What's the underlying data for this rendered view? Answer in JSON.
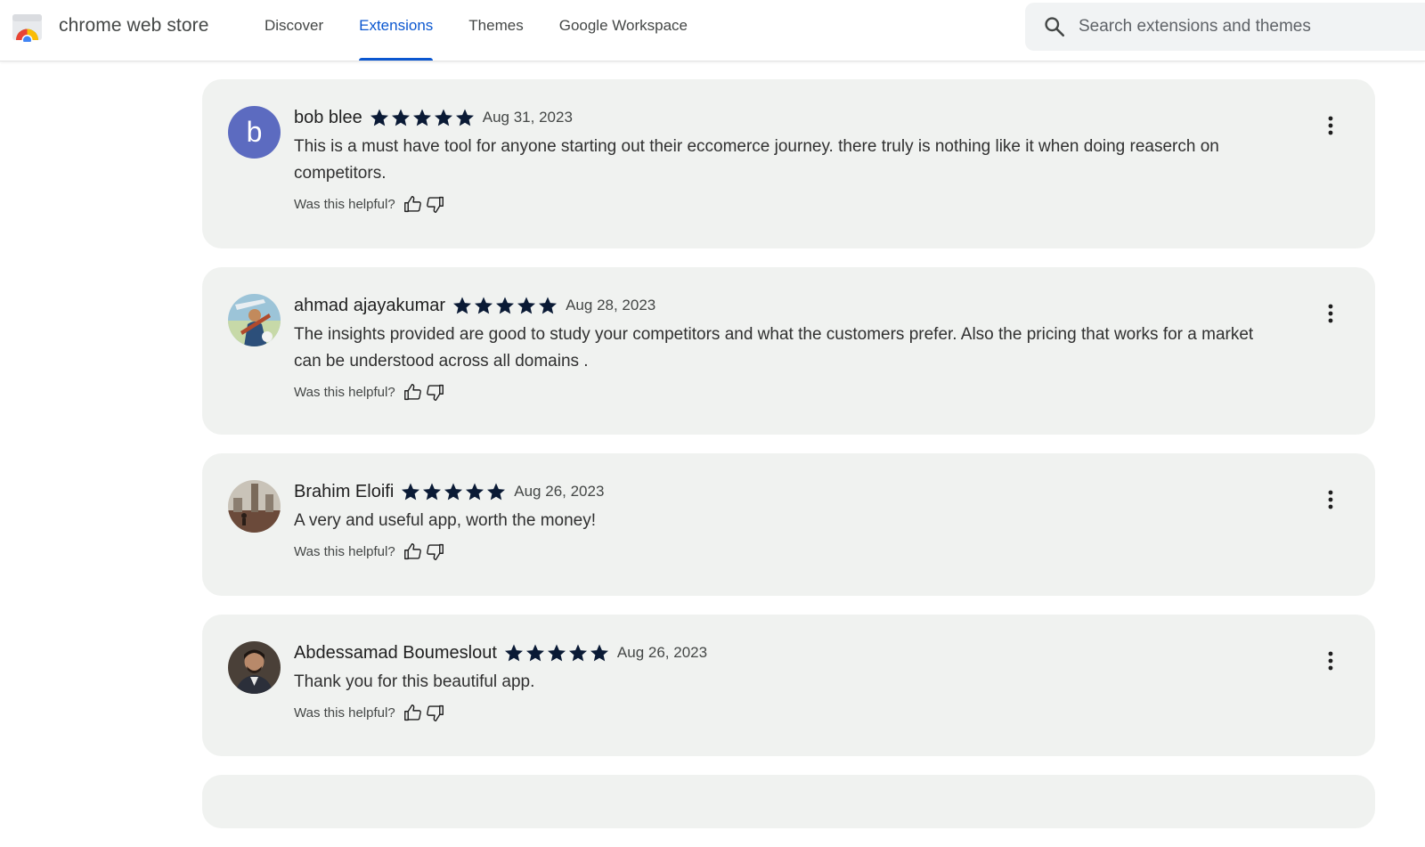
{
  "header": {
    "brand": "chrome web store",
    "nav": [
      "Discover",
      "Extensions",
      "Themes",
      "Google Workspace"
    ],
    "active_nav": "Extensions",
    "search_placeholder": "Search extensions and themes"
  },
  "reviews": [
    {
      "author": "bob blee",
      "rating": 5,
      "date": "Aug 31, 2023",
      "text": "This is a must have tool for anyone starting out their eccomerce journey. there truly is nothing like it when doing reaserch on competitors.",
      "avatar_letter": "b",
      "helpful_prompt": "Was this helpful?"
    },
    {
      "author": "ahmad ajayakumar",
      "rating": 5,
      "date": "Aug 28, 2023",
      "text": "The insights provided are good to study your competitors and what the customers prefer. Also the pricing that works for a market can be understood across all domains .",
      "helpful_prompt": "Was this helpful?"
    },
    {
      "author": "Brahim Eloifi",
      "rating": 5,
      "date": "Aug 26, 2023",
      "text": "A very and useful app, worth the money!",
      "helpful_prompt": "Was this helpful?"
    },
    {
      "author": "Abdessamad Boumeslout",
      "rating": 5,
      "date": "Aug 26, 2023",
      "text": "Thank you for this beautiful app.",
      "helpful_prompt": "Was this helpful?"
    }
  ],
  "colors": {
    "accent": "#0b57d0",
    "card_bg": "#f0f2f0",
    "star": "#0a1a35",
    "avatar_letter_bg": "#5c6bc0"
  }
}
